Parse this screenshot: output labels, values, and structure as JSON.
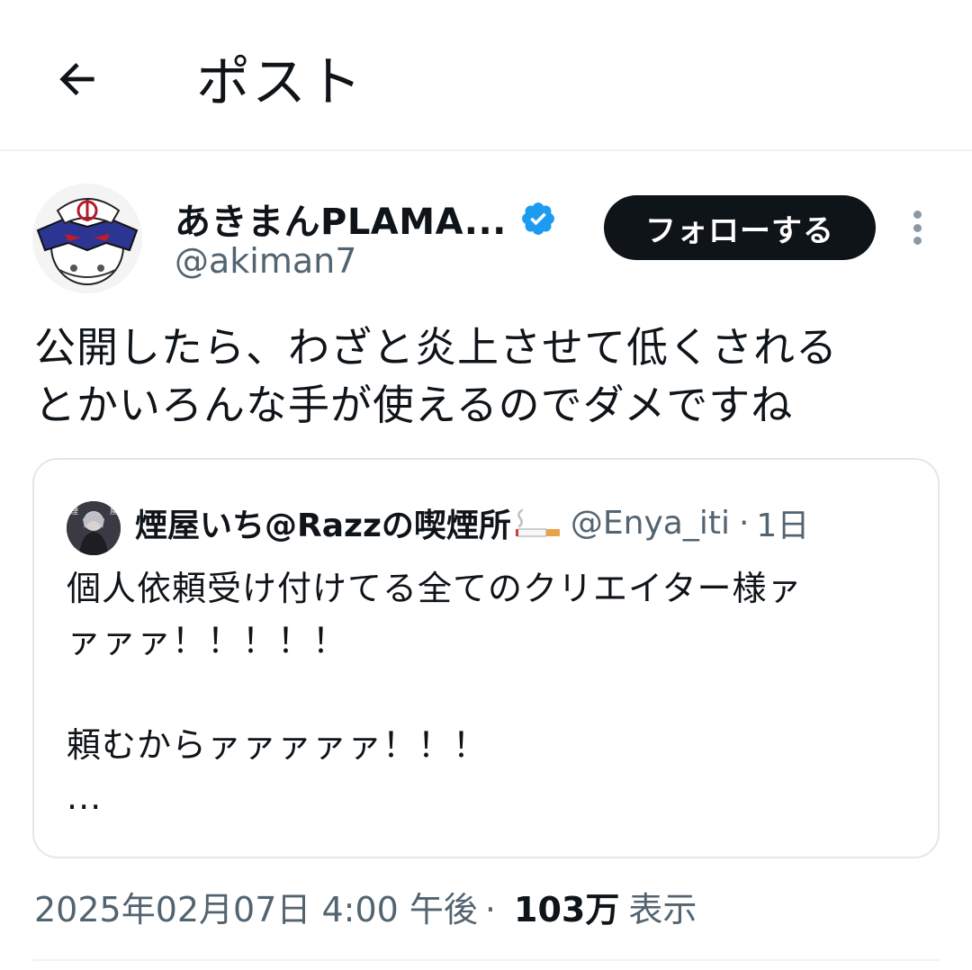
{
  "header": {
    "back_icon": "arrow-left-icon",
    "title": "ポスト"
  },
  "author": {
    "display_name": "あきまんPLAMA...",
    "verified_icon": "verified-badge-icon",
    "handle": "@akiman7",
    "follow_label": "フォローする",
    "more_icon": "more-vertical-icon"
  },
  "post": {
    "text_line1": "公開したら、わざと炎上させて低くされる",
    "text_line2": "とかいろんな手が使えるのでダメですね"
  },
  "quote": {
    "display_name": "煙屋いち@Razzの喫煙所",
    "name_emoji": "cigarette-icon",
    "handle": "@Enya_iti",
    "separator": "·",
    "time": "1日",
    "text": "個人依頼受け付けてる全てのクリエイター様ァ\nァァァ！！！！！\n\n頼むからァァァァァ！！！\n..."
  },
  "meta": {
    "timestamp": "2025年02月07日 4:00 午後",
    "separator": "·",
    "views_count": "103万",
    "views_label": "表示"
  },
  "colors": {
    "text_primary": "#0f1419",
    "text_secondary": "#536471",
    "verified_blue": "#1d9bf0",
    "border": "#e1e8ed",
    "button_bg": "#0f1419"
  }
}
